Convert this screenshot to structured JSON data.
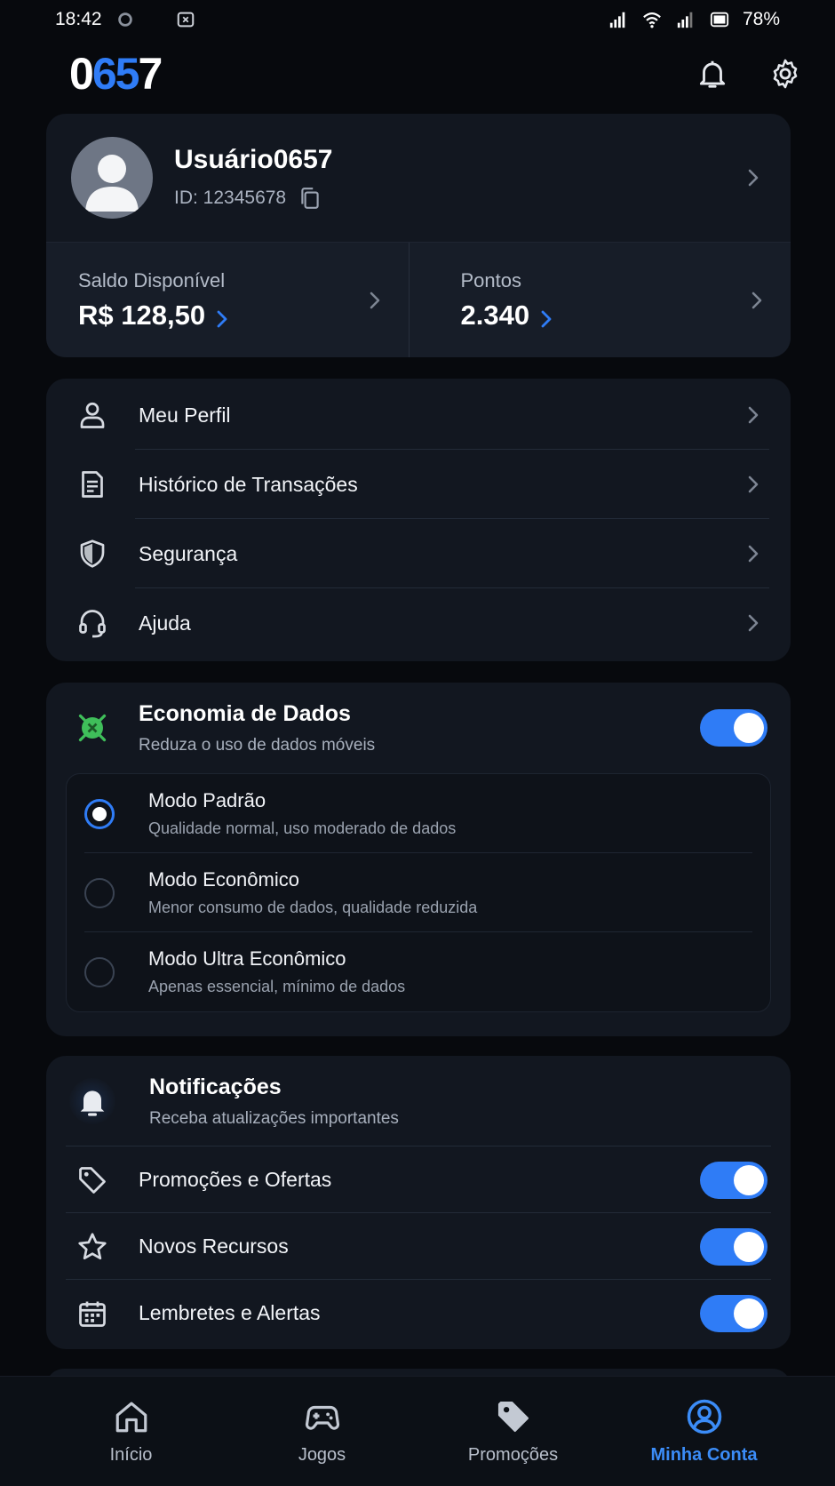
{
  "status_bar": {
    "time": "18:42",
    "battery": "78%"
  },
  "app": {
    "logo_part1": "0",
    "logo_part2": "65",
    "logo_part3": "7"
  },
  "profile": {
    "username": "Usuário0657",
    "id_text": "ID: 12345678",
    "balance_label": "Saldo Disponível",
    "balance_value": "R$ 128,50",
    "points_label": "Pontos",
    "points_value": "2.340"
  },
  "menu": {
    "items": [
      {
        "label": "Meu Perfil",
        "icon": "user-icon"
      },
      {
        "label": "Histórico de Transações",
        "icon": "document-icon"
      },
      {
        "label": "Segurança",
        "icon": "shield-icon"
      },
      {
        "label": "Ajuda",
        "icon": "headset-icon"
      }
    ]
  },
  "data_saver": {
    "title": "Economia de Dados",
    "subtitle": "Reduza o uso de dados móveis",
    "enabled": true,
    "modes": [
      {
        "title": "Modo Padrão",
        "subtitle": "Qualidade normal, uso moderado de dados",
        "selected": true
      },
      {
        "title": "Modo Econômico",
        "subtitle": "Menor consumo de dados, qualidade reduzida",
        "selected": false
      },
      {
        "title": "Modo Ultra Econômico",
        "subtitle": "Apenas essencial, mínimo de dados",
        "selected": false
      }
    ]
  },
  "notifications": {
    "title": "Notificações",
    "subtitle": "Receba atualizações importantes",
    "items": [
      {
        "label": "Promoções e Ofertas",
        "icon": "tag-icon",
        "enabled": true
      },
      {
        "label": "Novos Recursos",
        "icon": "star-icon",
        "enabled": true
      },
      {
        "label": "Lembretes e Alertas",
        "icon": "calendar-icon",
        "enabled": true
      }
    ]
  },
  "bottom_nav": {
    "items": [
      {
        "label": "Início",
        "icon": "home-icon",
        "active": false
      },
      {
        "label": "Jogos",
        "icon": "gamepad-icon",
        "active": false
      },
      {
        "label": "Promoções",
        "icon": "tag-icon",
        "active": false
      },
      {
        "label": "Minha Conta",
        "icon": "account-icon",
        "active": true
      }
    ]
  },
  "colors": {
    "accent": "#2f7cf6",
    "background": "#07090d",
    "card": "#121720",
    "active_nav": "#3b8cf7"
  }
}
